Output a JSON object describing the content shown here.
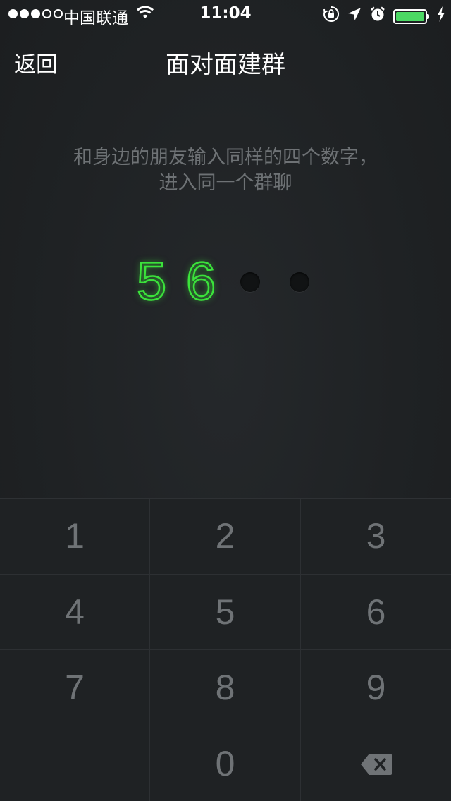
{
  "status_bar": {
    "carrier": "中国联通",
    "time": "11:04",
    "battery_level": 1.0,
    "signal_dots_filled": 3,
    "signal_dots_total": 5,
    "icons": [
      "wifi-icon",
      "rotation-lock-icon",
      "location-arrow-icon",
      "alarm-icon",
      "battery-icon",
      "charging-bolt-icon"
    ]
  },
  "nav": {
    "back_label": "返回",
    "title": "面对面建群"
  },
  "instructions": {
    "line1": "和身边的朋友输入同样的四个数字，",
    "line2": "进入同一个群聊"
  },
  "code": {
    "digits": [
      "5",
      "6",
      "",
      ""
    ]
  },
  "keypad": {
    "keys": [
      "1",
      "2",
      "3",
      "4",
      "5",
      "6",
      "7",
      "8",
      "9",
      "",
      "0",
      "backspace-icon"
    ]
  },
  "colors": {
    "digit_green": "#3be23b",
    "battery_green": "#4cd964",
    "background": "#202325",
    "key_text": "#6f7376"
  }
}
